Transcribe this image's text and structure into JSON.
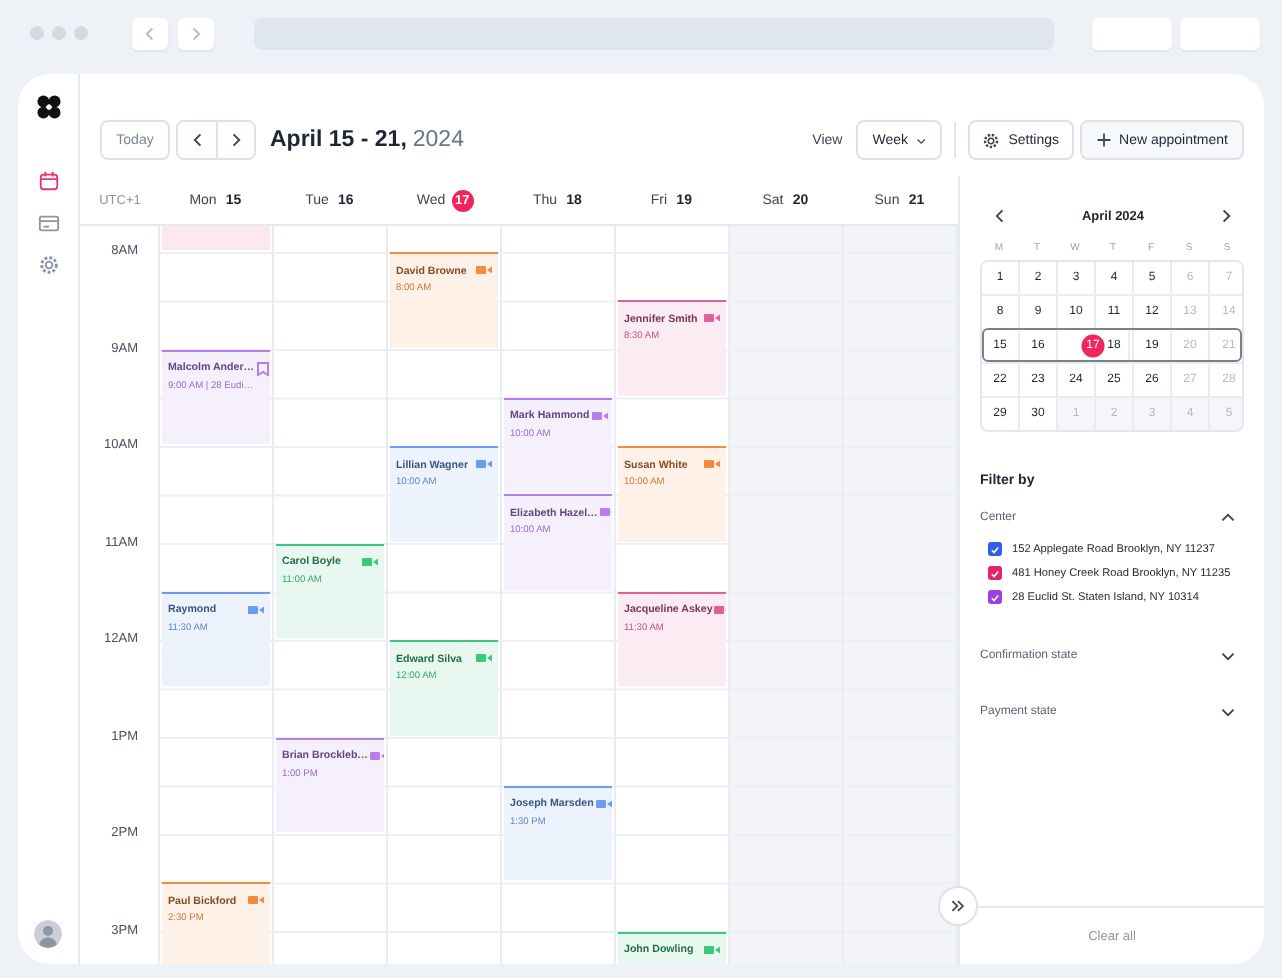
{
  "sidebar": {
    "items": [
      {
        "kind": "calendar",
        "selected": true
      },
      {
        "kind": "card",
        "selected": false
      },
      {
        "kind": "gear",
        "selected": false
      }
    ]
  },
  "toolbar": {
    "today_button": "Today",
    "title": "April 15 - 21,",
    "year": "2024",
    "view_label": "View",
    "view_value": "Week",
    "settings_button": "Settings",
    "new_button": "New appointment"
  },
  "calendar": {
    "timezone": "UTC+1",
    "hours": [
      "8AM",
      "9AM",
      "10AM",
      "11AM",
      "12AM",
      "1PM",
      "2PM",
      "3PM"
    ],
    "days": [
      {
        "name": "Mon",
        "date": "15",
        "today": false,
        "weekend": false,
        "timeline": [
          {
            "kind": "blank",
            "color": "#fbe8f0"
          },
          {
            "kind": "free"
          },
          {
            "kind": "free"
          },
          {
            "kind": "in_person",
            "name": "Malcolm Ander…",
            "time": "9:00 AM | 28 Eudi…",
            "color": "#b57ee8"
          },
          {
            "kind": "free"
          },
          {
            "kind": "free"
          },
          {
            "kind": "free"
          },
          {
            "kind": "video",
            "name": "Raymond",
            "time": "11:30 AM",
            "color": "#6c9cf0"
          },
          {
            "kind": "free"
          },
          {
            "kind": "free"
          },
          {
            "kind": "free"
          },
          {
            "kind": "free"
          },
          {
            "kind": "video",
            "name": "Paul Bickford",
            "time": "2:30 PM",
            "color": "#f58a3c"
          }
        ]
      },
      {
        "name": "Tue",
        "date": "16",
        "today": false,
        "weekend": false,
        "timeline": [
          {
            "kind": "free"
          },
          {
            "kind": "free"
          },
          {
            "kind": "free"
          },
          {
            "kind": "free"
          },
          {
            "kind": "free"
          },
          {
            "kind": "free"
          },
          {
            "kind": "free"
          },
          {
            "kind": "free"
          },
          {
            "kind": "video",
            "name": "Carol Boyle",
            "time": "11:00 AM",
            "color": "#3cc77f"
          },
          {
            "kind": "free"
          },
          {
            "kind": "free"
          },
          {
            "kind": "video",
            "name": "Brian Brockleb…",
            "time": "1:00 PM",
            "color": "#b57ee8"
          }
        ]
      },
      {
        "name": "Wed",
        "date": "17",
        "today": true,
        "weekend": false,
        "timeline": [
          {
            "kind": "free"
          },
          {
            "kind": "free"
          },
          {
            "kind": "video",
            "name": "David Browne",
            "time": "8:00 AM",
            "color": "#f58a3c"
          },
          {
            "kind": "free"
          },
          {
            "kind": "free"
          },
          {
            "kind": "video",
            "name": "Lillian Wagner",
            "time": "10:00 AM",
            "color": "#6c9cf0"
          },
          {
            "kind": "free"
          },
          {
            "kind": "free"
          },
          {
            "kind": "video",
            "name": "Edward Silva",
            "time": "12:00 AM",
            "color": "#3cc77f"
          }
        ]
      },
      {
        "name": "Thu",
        "date": "18",
        "today": false,
        "weekend": false,
        "timeline": [
          {
            "kind": "free"
          },
          {
            "kind": "free"
          },
          {
            "kind": "free"
          },
          {
            "kind": "free"
          },
          {
            "kind": "free"
          },
          {
            "kind": "video",
            "name": "Mark Hammond",
            "time": "10:00 AM",
            "color": "#b57ee8"
          },
          {
            "kind": "video",
            "name": "Elizabeth Hazel…",
            "time": "10:00 AM",
            "color": "#b57ee8"
          },
          {
            "kind": "free"
          },
          {
            "kind": "free"
          },
          {
            "kind": "free"
          },
          {
            "kind": "free"
          },
          {
            "kind": "video",
            "name": "Joseph Marsden",
            "time": "1:30 PM",
            "color": "#6c9cf0"
          }
        ]
      },
      {
        "name": "Fri",
        "date": "19",
        "today": false,
        "weekend": false,
        "timeline": [
          {
            "kind": "free"
          },
          {
            "kind": "free"
          },
          {
            "kind": "free"
          },
          {
            "kind": "video",
            "name": "Jennifer Smith",
            "time": "8:30 AM",
            "color": "#e0609a"
          },
          {
            "kind": "free"
          },
          {
            "kind": "video",
            "name": "Susan White",
            "time": "10:00 AM",
            "color": "#f58a3c"
          },
          {
            "kind": "free"
          },
          {
            "kind": "video",
            "name": "Jacqueline Askey",
            "time": "11:30 AM",
            "color": "#e0609a"
          },
          {
            "kind": "free"
          },
          {
            "kind": "free"
          },
          {
            "kind": "free"
          },
          {
            "kind": "free"
          },
          {
            "kind": "free"
          },
          {
            "kind": "video",
            "name": "John Dowling",
            "color": "#3cc77f"
          }
        ]
      },
      {
        "name": "Sat",
        "date": "20",
        "today": false,
        "weekend": true
      },
      {
        "name": "Sun",
        "date": "21",
        "today": false,
        "weekend": true
      }
    ]
  },
  "mini_calendar": {
    "title": "April 2024",
    "weekdays": [
      "M",
      "T",
      "W",
      "T",
      "F",
      "S",
      "S"
    ],
    "weeks": [
      {
        "selected": false,
        "days": [
          {
            "label": "1",
            "kind": "weekday",
            "today": false
          },
          {
            "label": "2",
            "kind": "weekday",
            "today": false
          },
          {
            "label": "3",
            "kind": "weekday",
            "today": false
          },
          {
            "label": "4",
            "kind": "weekday",
            "today": false
          },
          {
            "label": "5",
            "kind": "weekday",
            "today": false
          },
          {
            "label": "6",
            "kind": "weekend",
            "today": false
          },
          {
            "label": "7",
            "kind": "weekend",
            "today": false
          }
        ]
      },
      {
        "selected": false,
        "days": [
          {
            "label": "8",
            "kind": "weekday",
            "today": false
          },
          {
            "label": "9",
            "kind": "weekday",
            "today": false
          },
          {
            "label": "10",
            "kind": "weekday",
            "today": false
          },
          {
            "label": "11",
            "kind": "weekday",
            "today": false
          },
          {
            "label": "12",
            "kind": "weekday",
            "today": false
          },
          {
            "label": "13",
            "kind": "weekend",
            "today": false
          },
          {
            "label": "14",
            "kind": "weekend",
            "today": false
          }
        ]
      },
      {
        "selected": true,
        "days": [
          {
            "label": "15",
            "kind": "weekday",
            "today": false
          },
          {
            "label": "16",
            "kind": "weekday",
            "today": false
          },
          {
            "label": "17",
            "kind": "weekday",
            "today": true
          },
          {
            "label": "18",
            "kind": "weekday",
            "today": false
          },
          {
            "label": "19",
            "kind": "weekday",
            "today": false
          },
          {
            "label": "20",
            "kind": "weekend",
            "today": false
          },
          {
            "label": "21",
            "kind": "weekend",
            "today": false
          }
        ]
      },
      {
        "selected": false,
        "days": [
          {
            "label": "22",
            "kind": "weekday",
            "today": false
          },
          {
            "label": "23",
            "kind": "weekday",
            "today": false
          },
          {
            "label": "24",
            "kind": "weekday",
            "today": false
          },
          {
            "label": "25",
            "kind": "weekday",
            "today": false
          },
          {
            "label": "26",
            "kind": "weekday",
            "today": false
          },
          {
            "label": "27",
            "kind": "weekend",
            "today": false
          },
          {
            "label": "28",
            "kind": "weekend",
            "today": false
          }
        ]
      },
      {
        "selected": false,
        "days": [
          {
            "label": "29",
            "kind": "weekday",
            "today": false
          },
          {
            "label": "30",
            "kind": "weekday",
            "today": false
          },
          {
            "label": "1",
            "kind": "outside",
            "today": false
          },
          {
            "label": "2",
            "kind": "outside",
            "today": false
          },
          {
            "label": "3",
            "kind": "outside",
            "today": false
          },
          {
            "label": "4",
            "kind": "outside",
            "today": false
          },
          {
            "label": "5",
            "kind": "outside",
            "today": false
          }
        ]
      }
    ]
  },
  "filters": {
    "title": "Filter by",
    "sections": [
      {
        "label": "Center",
        "expanded": true,
        "options": [
          {
            "label": "152 Applegate Road Brooklyn, NY 11237",
            "checked": true,
            "color": "#2f62e8"
          },
          {
            "label": "481 Honey Creek Road Brooklyn, NY 11235",
            "checked": true,
            "color": "#e0246a"
          },
          {
            "label": "28 Euclid St. Staten Island, NY 10314",
            "checked": true,
            "color": "#9b3fe0"
          }
        ]
      },
      {
        "label": "Confirmation state",
        "expanded": false
      },
      {
        "label": "Payment state",
        "expanded": false
      }
    ],
    "clear_button": "Clear all"
  }
}
